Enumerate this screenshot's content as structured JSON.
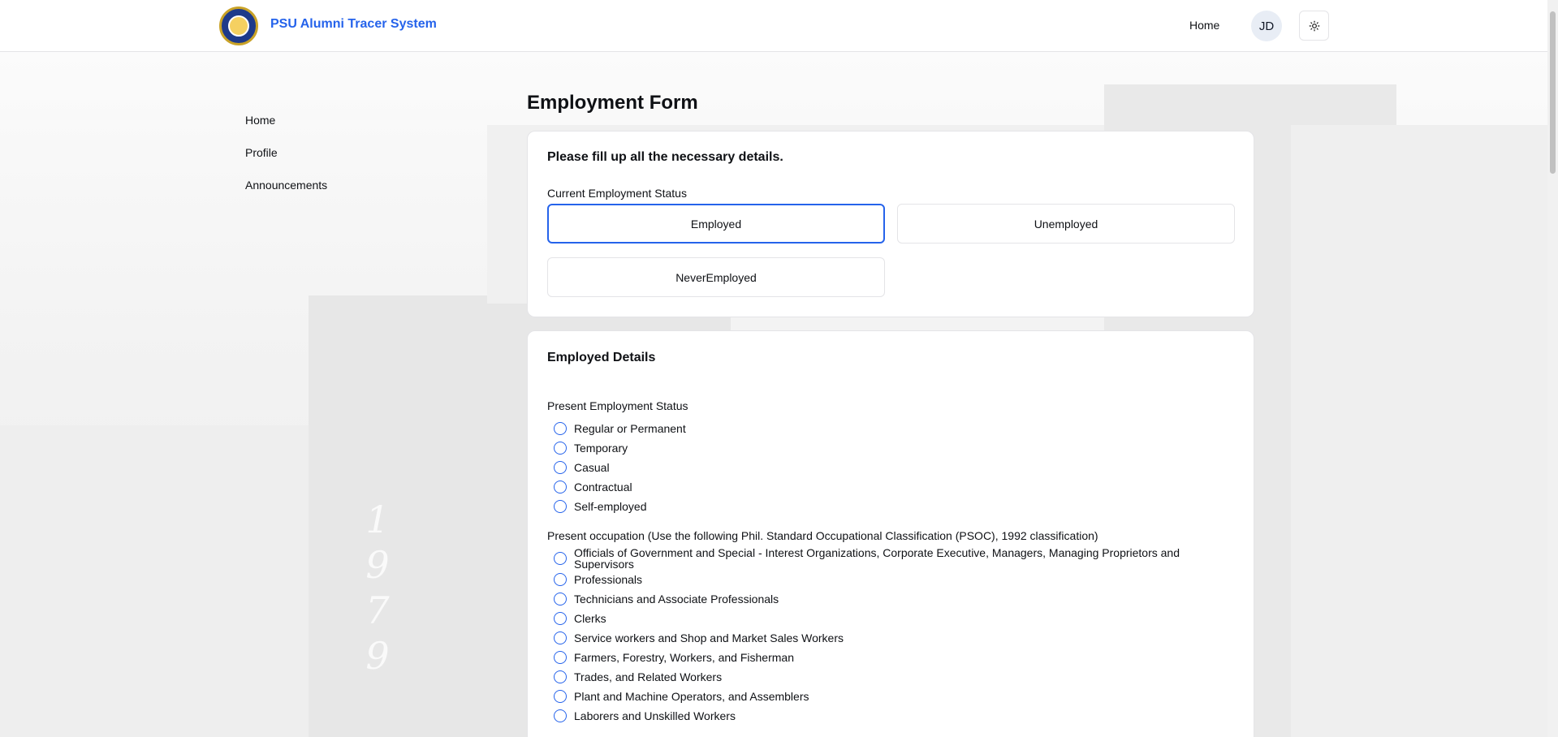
{
  "header": {
    "brand": "PSU Alumni Tracer System",
    "home_link": "Home",
    "avatar_initials": "JD",
    "theme_icon": "sun-icon"
  },
  "sidebar": {
    "items": [
      {
        "label": "Home"
      },
      {
        "label": "Profile"
      },
      {
        "label": "Announcements"
      }
    ]
  },
  "main": {
    "title": "Employment Form",
    "status_card": {
      "heading": "Please fill up all the necessary details.",
      "label": "Current Employment Status",
      "options": [
        "Employed",
        "Unemployed",
        "NeverEmployed"
      ],
      "selected": "Employed"
    },
    "details_card": {
      "heading": "Employed Details",
      "present_status_label": "Present Employment Status",
      "present_status_options": [
        "Regular or Permanent",
        "Temporary",
        "Casual",
        "Contractual",
        "Self-employed"
      ],
      "occupation_label": "Present occupation (Use the following Phil. Standard Occupational Classification (PSOC), 1992 classification)",
      "occupation_options": [
        "Officials of Government and Special - Interest Organizations, Corporate Executive, Managers, Managing Proprietors and Supervisors",
        "Professionals",
        "Technicians and Associate Professionals",
        "Clerks",
        "Service workers and Shop and Market Sales Workers",
        "Farmers, Forestry, Workers, and Fisherman",
        "Trades, and Related Workers",
        "Plant and Machine Operators, and Assemblers",
        "Laborers and Unskilled Workers"
      ]
    }
  },
  "colors": {
    "brand": "#2563eb",
    "border": "#e4e4e7",
    "text": "#0f1115"
  }
}
